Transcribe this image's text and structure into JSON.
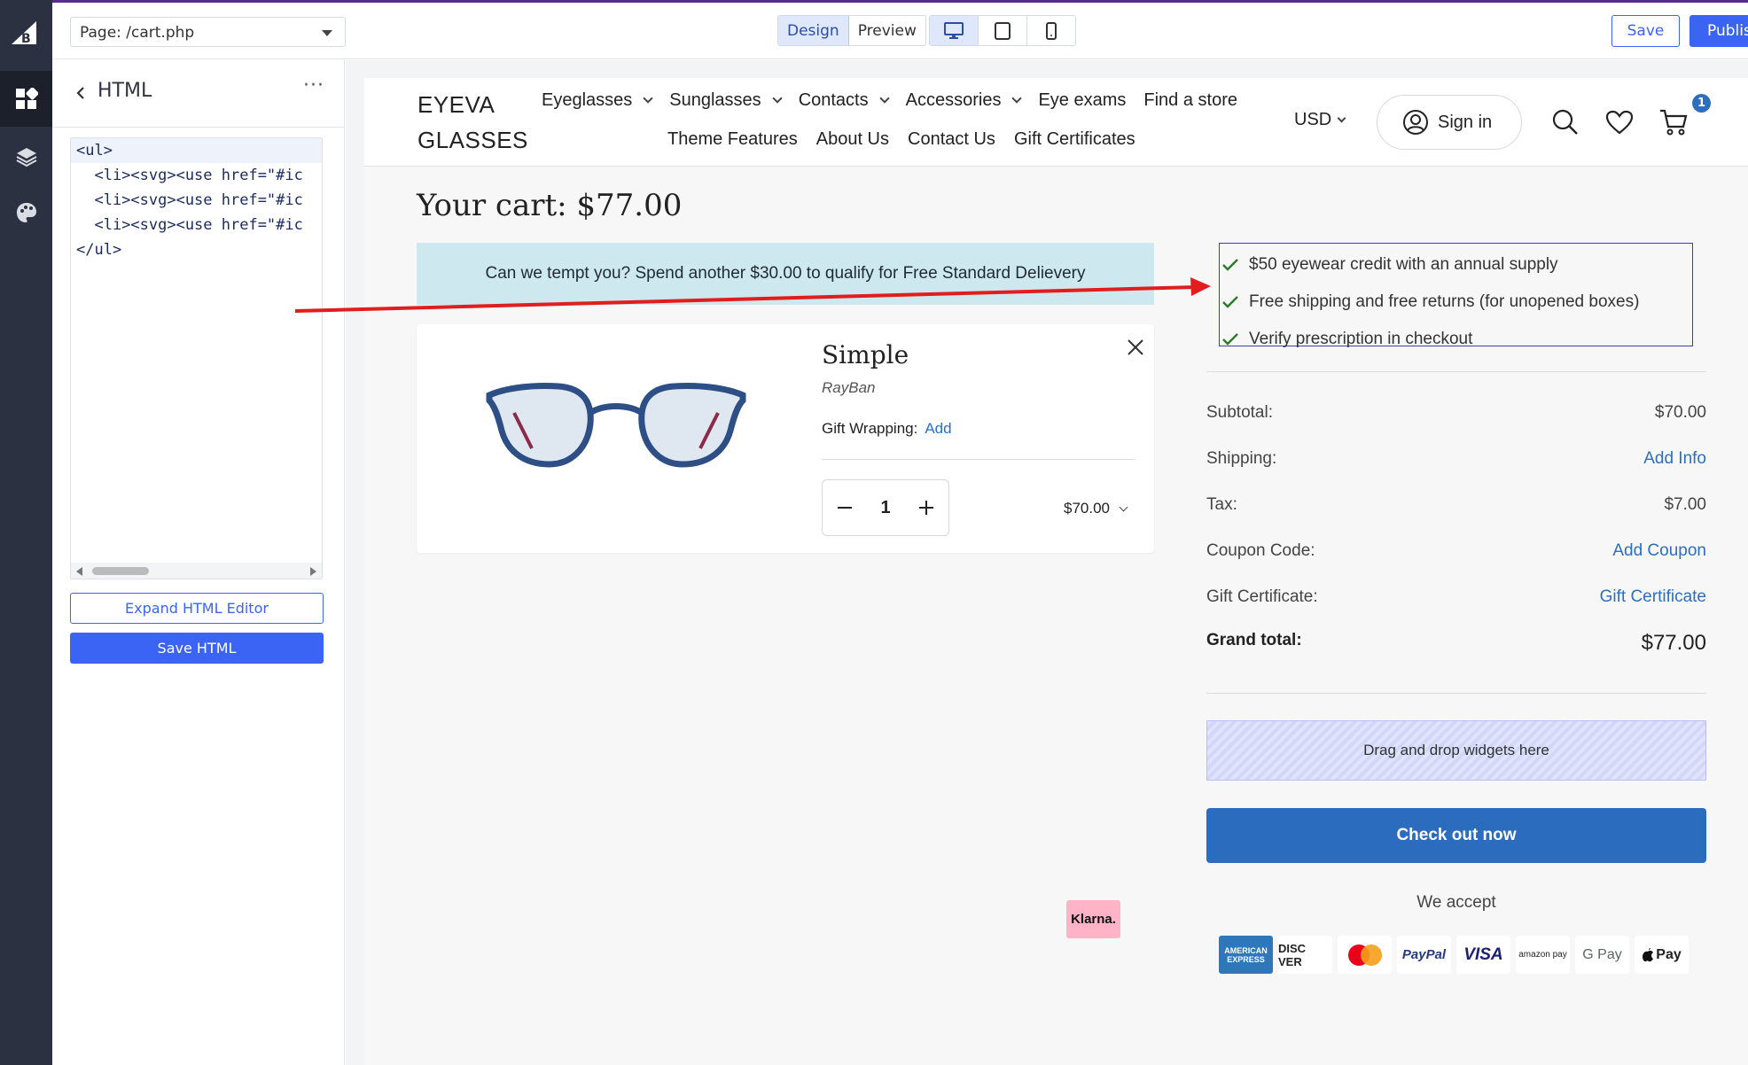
{
  "editor": {
    "page_select": "Page: /cart.php",
    "mode_design": "Design",
    "mode_preview": "Preview",
    "save": "Save",
    "publish": "Publish"
  },
  "panel": {
    "title": "HTML",
    "more": "···",
    "code_lines": [
      "<ul>",
      "  <li><svg><use href=\"#ic",
      "  <li><svg><use href=\"#ic",
      "  <li><svg><use href=\"#ic",
      "</ul>"
    ],
    "expand_label": "Expand HTML Editor",
    "save_html_label": "Save HTML"
  },
  "store": {
    "logo_line1": "EYEVA",
    "logo_line2": "GLASSES",
    "nav_primary": [
      "Eyeglasses",
      "Sunglasses",
      "Contacts",
      "Accessories",
      "Eye exams",
      "Find a store"
    ],
    "nav_secondary": [
      "Theme Features",
      "About Us",
      "Contact Us",
      "Gift Certificates"
    ],
    "currency": "USD",
    "sign_in": "Sign in",
    "cart_count": "1"
  },
  "cart": {
    "title": "Your cart: $77.00",
    "promo": "Can we tempt you? Spend another $30.00 to qualify for Free Standard Delievery",
    "item": {
      "name": "Simple",
      "brand": "RayBan",
      "gift_label": "Gift Wrapping:",
      "gift_link": "Add",
      "quantity": "1",
      "price": "$70.00"
    },
    "benefits": [
      "$50 eyewear credit with an annual supply",
      "Free shipping and free returns (for unopened boxes)",
      "Verify prescription in checkout"
    ],
    "summary": {
      "subtotal_label": "Subtotal:",
      "subtotal_value": "$70.00",
      "shipping_label": "Shipping:",
      "shipping_value": "Add Info",
      "tax_label": "Tax:",
      "tax_value": "$7.00",
      "coupon_label": "Coupon Code:",
      "coupon_value": "Add Coupon",
      "gift_label": "Gift Certificate:",
      "gift_value": "Gift Certificate",
      "total_label": "Grand total:",
      "total_value": "$77.00"
    },
    "dropzone": "Drag and drop widgets here",
    "checkout": "Check out now",
    "we_accept": "We accept",
    "payments": {
      "amex": "AMERICAN EXPRESS",
      "discover": "DISC VER",
      "paypal": "PayPal",
      "visa": "VISA",
      "amazon": "amazon pay",
      "gpay": "G Pay",
      "apple": "Pay",
      "klarna": "Klarna."
    }
  },
  "colors": {
    "accent": "#3c64f4",
    "rail": "#2b3140",
    "checkout": "#2b6cbf",
    "promo_bg": "#cde8ee",
    "annotation_arrow": "#e11d1d"
  }
}
